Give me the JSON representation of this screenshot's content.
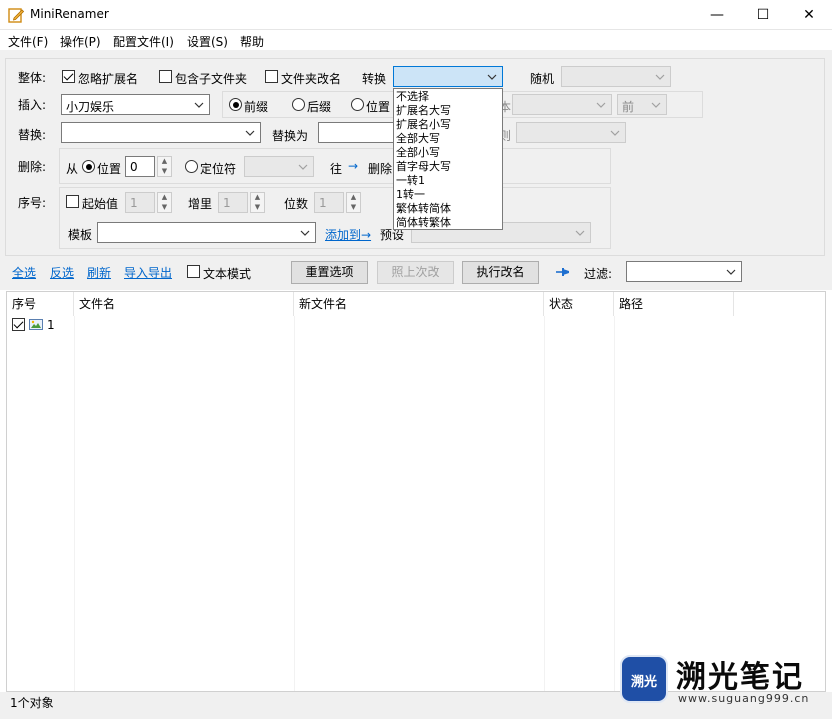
{
  "window": {
    "title": "MiniRenamer",
    "minimize": "—",
    "maximize": "☐",
    "close": "✕"
  },
  "menu": [
    "文件(F)",
    "操作(P)",
    "配置文件(I)",
    "设置(S)",
    "帮助"
  ],
  "overall": {
    "label": "整体:",
    "ignore_ext": "忽略扩展名",
    "include_sub": "包含子文件夹",
    "folder_rename": "文件夹改名",
    "convert_label": "转换",
    "convert_value": "",
    "random_label": "随机",
    "random_value": ""
  },
  "insert": {
    "label": "插入:",
    "value": "小刀娱乐",
    "prefix": "前缀",
    "suffix": "后缀",
    "position": "位置",
    "partial_label": "本",
    "front_value": "前"
  },
  "replace": {
    "label": "替换:",
    "value": "",
    "replace_with": "替换为",
    "partial_label": "则"
  },
  "delete": {
    "label": "删除:",
    "from": "从",
    "position": "位置",
    "position_value": "0",
    "locator": "定位符",
    "to": "往",
    "arrow": "→",
    "delete_text": "删除"
  },
  "sequence": {
    "label": "序号:",
    "start": "起始值",
    "start_value": "1",
    "increment": "增里",
    "increment_value": "1",
    "digits": "位数",
    "digits_value": "1",
    "template": "模板",
    "template_value": "",
    "add_to": "添加到→",
    "preset": "预设"
  },
  "convert_options": [
    "不选择",
    "扩展名大写",
    "扩展名小写",
    "全部大写",
    "全部小写",
    "首字母大写",
    "一转1",
    "1转一",
    "繁体转简体",
    "简体转繁体"
  ],
  "toolbar": {
    "select_all": "全选",
    "invert": "反选",
    "refresh": "刷新",
    "import_export": "导入导出",
    "text_mode": "文本模式",
    "reset": "重置选项",
    "last": "照上次改",
    "execute": "执行改名",
    "filter": "过滤:",
    "filter_value": ""
  },
  "table": {
    "columns": [
      "序号",
      "文件名",
      "新文件名",
      "状态",
      "路径"
    ],
    "rows": [
      {
        "index": "1",
        "filename": "",
        "newname": "",
        "status": "",
        "path": ""
      }
    ]
  },
  "status": "1个对象",
  "watermark": {
    "badge": "溯光",
    "title": "溯光笔记",
    "url": "www.suguang999.cn"
  },
  "colors": {
    "accent": "#0066cc",
    "dropdown_highlight": "#cce4f7",
    "watermark_badge": "#1f4fa6"
  }
}
